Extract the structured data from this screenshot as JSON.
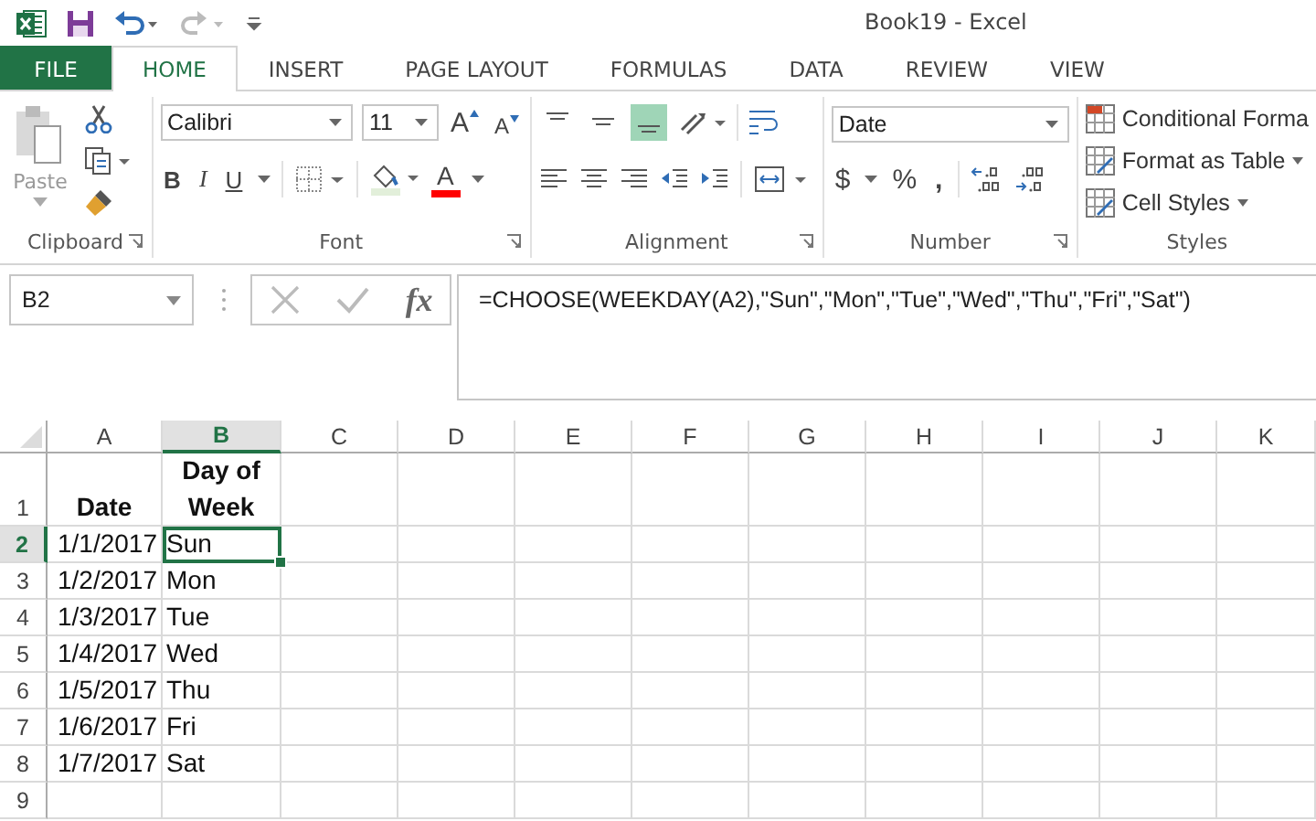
{
  "window": {
    "title": "Book19 - Excel"
  },
  "tabs": [
    {
      "label": "FILE",
      "kind": "file",
      "selected": false
    },
    {
      "label": "HOME",
      "kind": "tab",
      "selected": true
    },
    {
      "label": "INSERT",
      "kind": "tab",
      "selected": false
    },
    {
      "label": "PAGE LAYOUT",
      "kind": "tab",
      "selected": false
    },
    {
      "label": "FORMULAS",
      "kind": "tab",
      "selected": false
    },
    {
      "label": "DATA",
      "kind": "tab",
      "selected": false
    },
    {
      "label": "REVIEW",
      "kind": "tab",
      "selected": false
    },
    {
      "label": "VIEW",
      "kind": "tab",
      "selected": false
    }
  ],
  "ribbon": {
    "clipboard": {
      "paste": "Paste",
      "label": "Clipboard"
    },
    "font": {
      "name": "Calibri",
      "size": "11",
      "grow": "A",
      "shrink": "A",
      "bold": "B",
      "italic": "I",
      "underline": "U",
      "color_letter": "A",
      "label": "Font"
    },
    "alignment": {
      "vertical": [
        {
          "selected": false
        },
        {
          "selected": false
        },
        {
          "selected": true
        }
      ],
      "label": "Alignment"
    },
    "number": {
      "format": "Date",
      "currency": "$",
      "percent": "%",
      "comma": ",",
      "label": "Number"
    },
    "styles": {
      "items": [
        "Conditional Forma",
        "Format as Table",
        "Cell Styles"
      ],
      "label": "Styles"
    }
  },
  "name_box": "B2",
  "fx": "fx",
  "formula": "=CHOOSE(WEEKDAY(A2),\"Sun\",\"Mon\",\"Tue\",\"Wed\",\"Thu\",\"Fri\",\"Sat\")",
  "columns": [
    {
      "label": "A",
      "selected": false
    },
    {
      "label": "B",
      "selected": true
    },
    {
      "label": "C",
      "selected": false
    },
    {
      "label": "D",
      "selected": false
    },
    {
      "label": "E",
      "selected": false
    },
    {
      "label": "F",
      "selected": false
    },
    {
      "label": "G",
      "selected": false
    },
    {
      "label": "H",
      "selected": false
    },
    {
      "label": "I",
      "selected": false
    },
    {
      "label": "J",
      "selected": false
    },
    {
      "label": "K",
      "selected": false
    }
  ],
  "rows": [
    {
      "label": "1",
      "kind": "header",
      "selected": false,
      "cells": [
        {
          "text": "Date",
          "kind": "text"
        },
        {
          "text": "Day of Week",
          "kind": "text"
        }
      ]
    },
    {
      "label": "2",
      "kind": "data",
      "selected": true,
      "cells": [
        {
          "text": "1/1/2017",
          "kind": "number"
        },
        {
          "text": "Sun",
          "kind": "text"
        }
      ]
    },
    {
      "label": "3",
      "kind": "data",
      "selected": false,
      "cells": [
        {
          "text": "1/2/2017",
          "kind": "number"
        },
        {
          "text": "Mon",
          "kind": "text"
        }
      ]
    },
    {
      "label": "4",
      "kind": "data",
      "selected": false,
      "cells": [
        {
          "text": "1/3/2017",
          "kind": "number"
        },
        {
          "text": "Tue",
          "kind": "text"
        }
      ]
    },
    {
      "label": "5",
      "kind": "data",
      "selected": false,
      "cells": [
        {
          "text": "1/4/2017",
          "kind": "number"
        },
        {
          "text": "Wed",
          "kind": "text"
        }
      ]
    },
    {
      "label": "6",
      "kind": "data",
      "selected": false,
      "cells": [
        {
          "text": "1/5/2017",
          "kind": "number"
        },
        {
          "text": "Thu",
          "kind": "text"
        }
      ]
    },
    {
      "label": "7",
      "kind": "data",
      "selected": false,
      "cells": [
        {
          "text": "1/6/2017",
          "kind": "number"
        },
        {
          "text": "Fri",
          "kind": "text"
        }
      ]
    },
    {
      "label": "8",
      "kind": "data",
      "selected": false,
      "cells": [
        {
          "text": "1/7/2017",
          "kind": "number"
        },
        {
          "text": "Sat",
          "kind": "text"
        }
      ]
    },
    {
      "label": "9",
      "kind": "data",
      "selected": false
    }
  ]
}
